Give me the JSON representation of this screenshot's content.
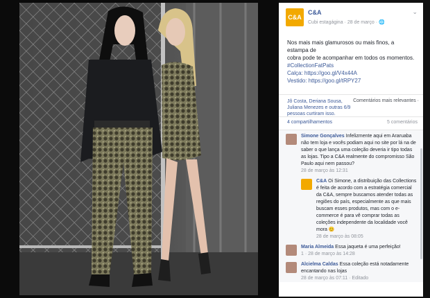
{
  "post": {
    "page_name": "C&A",
    "logo_text": "C&A",
    "author_line": "Cubi estagágina",
    "date": "28 de março",
    "globe_icon": "globe-icon",
    "caption_lines": [
      "Nos mais mais glamurosos ou mais finos, a estampa de",
      "cobra pode te acompanhar em todos os momentos.",
      "#CollectionFatPats",
      "Calça: https://goo.gl/V4x44A",
      "Vestido: https://goo.gl/tRPY27"
    ],
    "likes_text": "Jô Costa, Deriana Sousa, Juliana Menezes e outras 6/9 pessoas curtiram isso.",
    "sort_label": "Comentários mais relevantes ·",
    "shares_label": "4 compartilhamentos",
    "comment_count": "5 comentários"
  },
  "comments": [
    {
      "name": "Simone Gonçalves",
      "text": "Infelizmente aqui em Araruaba não tem loja e vocês podiam aqui no site por lá na de saber o que lança uma coleção deveria ir tipo todas as lojas. Tipo a C&A realmente do compromisso São Paulo aqui nem passou?",
      "time": "28 de março às 12:31",
      "reply": {
        "name": "C&A",
        "text": "Oi Simone, a distribuição das Collections é feita de acordo com a estratégia comercial da C&A, sempre buscamos atender todas as regiões do país, especialmente as que mais buscam esses produtos, mas com o e-commerce é para vê comprar todas as coleções independente da localidade você mora 😊",
        "time": "28 de março às 08:05"
      }
    },
    {
      "name": "Maria Almeida",
      "text": "Essa jaqueta é uma perfeição!",
      "time": "1 · 28 de março às 14:28"
    },
    {
      "name": "Alcielma Caldas",
      "text": "Essa coleção está notadamente encantando nas lojas",
      "time": "28 de março às 07:11 · Editado"
    }
  ]
}
